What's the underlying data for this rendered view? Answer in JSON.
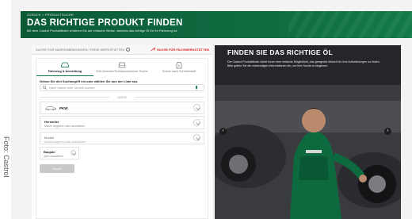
{
  "credit": "Foto: Castrol",
  "hero": {
    "back": "ZURÜCK > PRODUKTSUCHE",
    "title": "DAS RICHTIGE PRODUKT FINDEN",
    "subtitle": "Mit dem Castrol Produktfinder erfahren Sie auf einfache Weise, welches das richtige Öl für Ihr Fahrzeug ist."
  },
  "toprow": {
    "left_tab": "SUCHE FÜR MARKENBINDUNGEN / FREIE WERKSTÄTTEN",
    "right_tab": "SUCHE FÜR FACHWERKSTÄTTEN"
  },
  "tabs": [
    {
      "label": "Fahrzeug & Anmeldung",
      "icon": "car-icon"
    },
    {
      "label": "KW-Nummer/Schlüsselnummer Suche",
      "icon": "car-front-icon"
    },
    {
      "label": "Suche nach Schmierstoff",
      "icon": "oil-bottle-icon"
    }
  ],
  "form": {
    "prompt": "Geben Sie den Suchbegriff ein oder wählen Sie aus der Liste aus.",
    "search_placeholder": "Nach Marke oder Modell suchen",
    "oder": "ODER",
    "vehicle_type": "PKW",
    "hersteller_label": "Hersteller",
    "hersteller_sub": "Marke angeben oder auswählen",
    "modell_label": "Modell",
    "modell_sub": "Modell angeben oder auswählen",
    "baujahr_label": "Baujahr",
    "baujahr_sub": "Jahr auswählen",
    "submit": "Suche"
  },
  "promo": {
    "title": "FINDEN SIE DAS RICHTIGE ÖL",
    "text": "Der Castrol Produktfinder bietet Ihnen eine einfache Möglichkeit, das geeignete Motoröl für Ihre Anforderungen zu finden. Bitte geben Sie die notwendigen Informationen ein, um Ihre Suche zu beginnen."
  },
  "colors": {
    "brand_green": "#0f6b40",
    "accent_red": "#dd2222"
  }
}
